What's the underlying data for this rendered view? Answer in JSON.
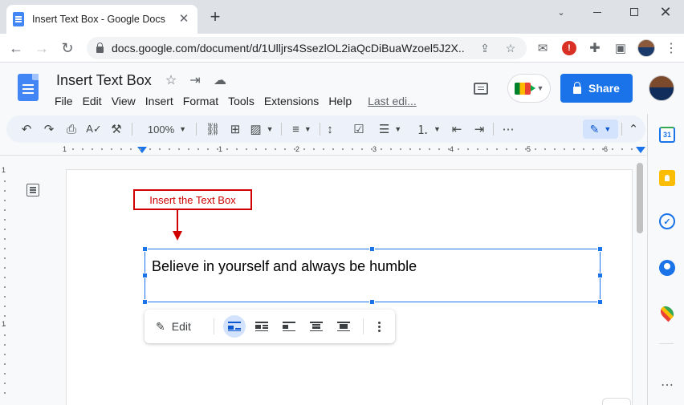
{
  "browser": {
    "tab_title": "Insert Text Box - Google Docs",
    "new_tab_symbol": "+",
    "url": "docs.google.com/document/d/1Ulljrs4SsezlOL2iaQcDiBuaWzoel5J2X...",
    "window_controls": {
      "caret": "⌄",
      "close": "✕"
    }
  },
  "docs": {
    "title": "Insert Text Box",
    "menu": [
      "File",
      "Edit",
      "View",
      "Insert",
      "Format",
      "Tools",
      "Extensions",
      "Help"
    ],
    "last_edit": "Last edi...",
    "share_label": "Share"
  },
  "toolbar": {
    "zoom": "100%"
  },
  "ruler": {
    "numbers": [
      "1",
      "1",
      "2",
      "3",
      "4",
      "5",
      "6"
    ],
    "vertical_numbers": [
      "1",
      "1"
    ]
  },
  "annotation": {
    "callout_text": "Insert the Text Box",
    "color": "#d00000"
  },
  "textbox": {
    "content": "Believe in yourself and always be humble"
  },
  "image_toolbar": {
    "edit_label": "Edit",
    "wrap_options": [
      "in-line",
      "wrap-text",
      "break-text",
      "behind-text",
      "in-front-of-text"
    ],
    "active_wrap": "in-line"
  },
  "side_panel": {
    "calendar_day": "31",
    "tasks_symbol": "✓",
    "more_symbol": "⋯"
  },
  "colors": {
    "accent": "#1a73e8",
    "toolbar_bg": "#edf2fa",
    "share_bg": "#1a73e8"
  }
}
